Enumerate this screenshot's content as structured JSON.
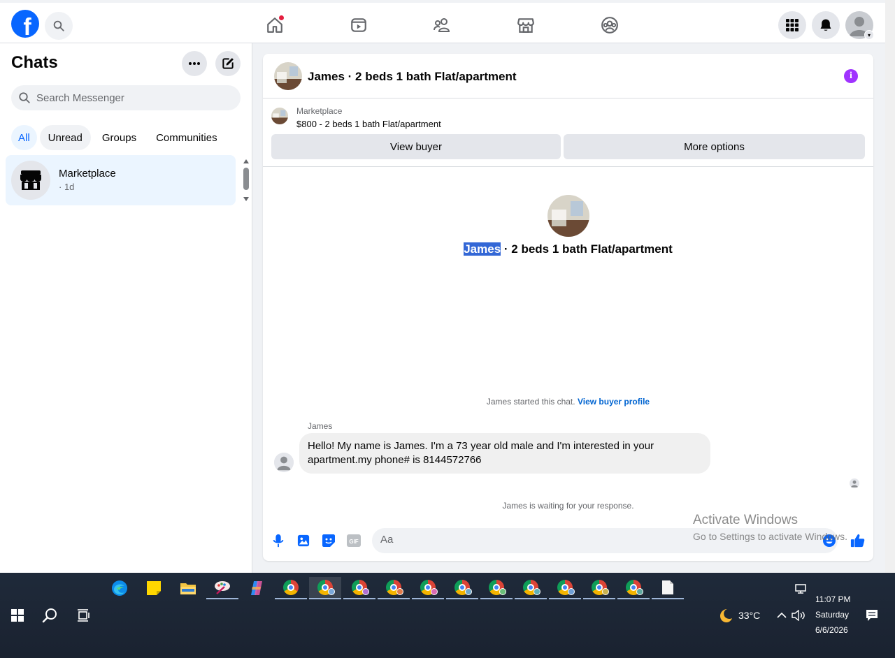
{
  "topbar": {
    "logo": "f",
    "nav_icons": [
      "home-icon",
      "video-icon",
      "friends-icon",
      "marketplace-icon",
      "groups-icon"
    ],
    "right_icons": [
      "menu-grid-icon",
      "bell-icon",
      "profile-avatar"
    ]
  },
  "sidebar": {
    "title": "Chats",
    "search_placeholder": "Search Messenger",
    "filters": [
      "All",
      "Unread",
      "Groups",
      "Communities"
    ],
    "chats": [
      {
        "name": "Marketplace",
        "time": "· 1d"
      }
    ]
  },
  "conversation": {
    "title": "James · 2 beds 1 bath Flat/apartment",
    "banner": {
      "label": "Marketplace",
      "listing": "$800 - 2 beds 1 bath Flat/apartment",
      "view_buyer": "View buyer",
      "more_options": "More options"
    },
    "intro": {
      "name_highlight": "James",
      "title_rest": " · 2 beds 1 bath Flat/apartment"
    },
    "started_text": "James started this chat.",
    "view_profile_link": "View buyer profile",
    "messages": [
      {
        "sender": "James",
        "text": "Hello! My name is James. I'm a 73 year old male and I'm interested in your apartment.my phone# is 8144572766"
      }
    ],
    "waiting_text": "James is waiting for your response.",
    "composer_placeholder": "Aa"
  },
  "watermark": {
    "line1": "Activate Windows",
    "line2": "Go to Settings to activate Windows."
  },
  "taskbar": {
    "weather": "33°C",
    "time": "11:07 PM",
    "day": "Saturday",
    "date": "6/6/2026"
  },
  "colors": {
    "facebook_blue": "#0866ff",
    "selected_bg": "#ebf5ff",
    "info_purple": "#a033ff"
  }
}
